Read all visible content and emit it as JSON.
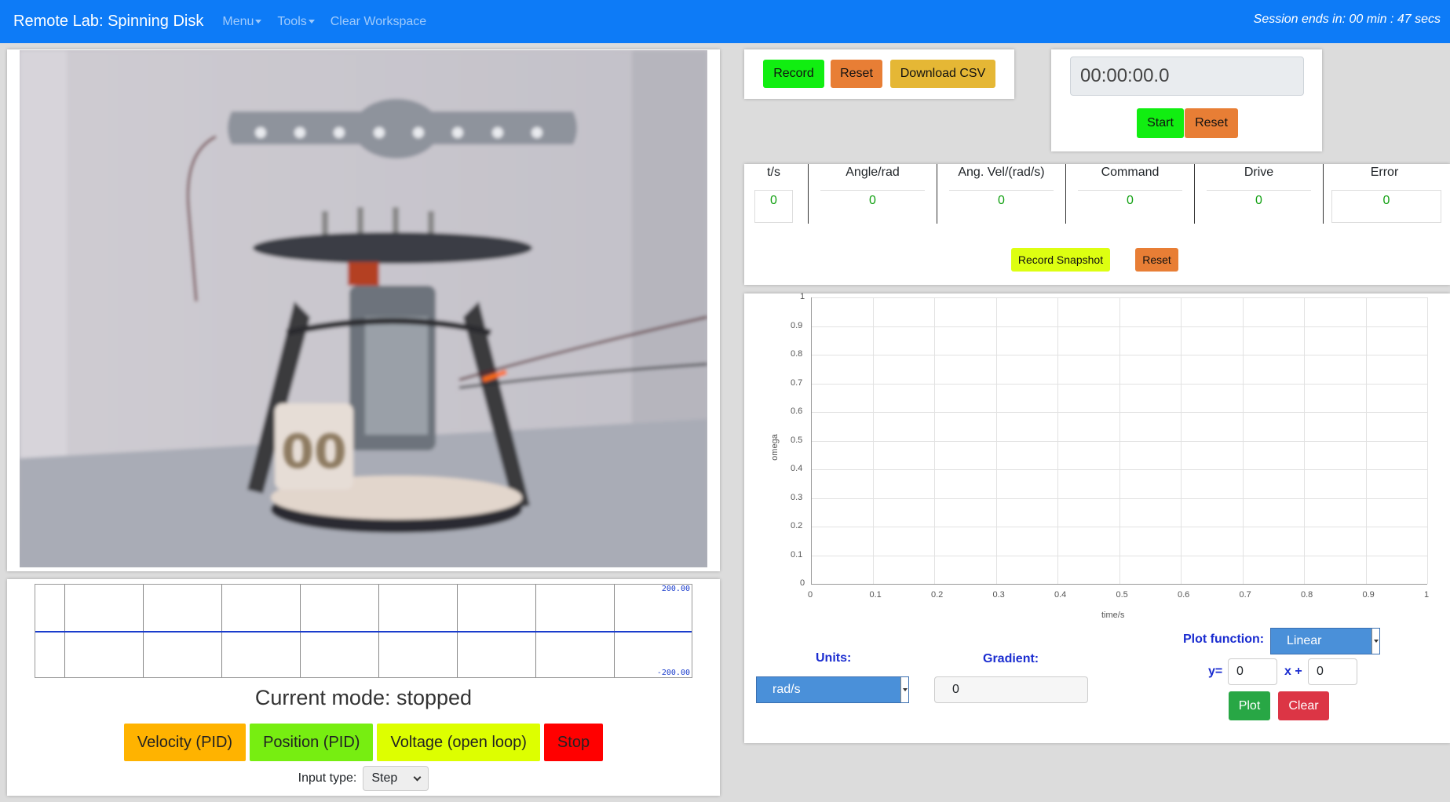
{
  "navbar": {
    "brand": "Remote Lab: Spinning Disk",
    "menu": "Menu",
    "tools": "Tools",
    "clear": "Clear Workspace",
    "session": "Session ends in: 00 min : 47 secs"
  },
  "video": {
    "disk_label": "00"
  },
  "strip_chart": {
    "max_label": "200.00",
    "min_label": "-200.00"
  },
  "mode": {
    "text": "Current mode: stopped"
  },
  "mode_buttons": [
    {
      "label": "Velocity (PID)",
      "color": "#ffb300"
    },
    {
      "label": "Position (PID)",
      "color": "#77ee11"
    },
    {
      "label": "Voltage (open loop)",
      "color": "#ddff00"
    },
    {
      "label": "Stop",
      "color": "#ff0000"
    }
  ],
  "input_type": {
    "label": "Input type:",
    "value": "Step"
  },
  "record": {
    "record": "Record",
    "reset": "Reset",
    "download": "Download CSV"
  },
  "timer": {
    "display": "00:00:00.0",
    "start": "Start",
    "reset": "Reset"
  },
  "table": {
    "columns": [
      {
        "header": "t/s",
        "value": "0"
      },
      {
        "header": "Angle/rad",
        "value": "0"
      },
      {
        "header": "Ang. Vel/(rad/s)",
        "value": "0"
      },
      {
        "header": "Command",
        "value": "0"
      },
      {
        "header": "Drive",
        "value": "0"
      },
      {
        "header": "Error",
        "value": "0"
      }
    ],
    "snapshot": "Record Snapshot",
    "reset": "Reset"
  },
  "chart_data": {
    "type": "line",
    "title": "",
    "xlabel": "time/s",
    "ylabel": "omega",
    "xlim": [
      0,
      1
    ],
    "ylim": [
      0,
      1
    ],
    "x_ticks": [
      "0",
      "0.1",
      "0.2",
      "0.3",
      "0.4",
      "0.5",
      "0.6",
      "0.7",
      "0.8",
      "0.9",
      "1"
    ],
    "y_ticks": [
      "0",
      "0.1",
      "0.2",
      "0.3",
      "0.4",
      "0.5",
      "0.6",
      "0.7",
      "0.8",
      "0.9",
      "1"
    ],
    "grid": true,
    "series": []
  },
  "graph_controls": {
    "units_label": "Units:",
    "units_value": "rad/s",
    "gradient_label": "Gradient:",
    "gradient_value": "0",
    "plot_function_label": "Plot function:",
    "plot_function_value": "Linear",
    "y_eq": "y=",
    "m_value": "0",
    "x_plus": "x +",
    "c_value": "0",
    "plot": "Plot",
    "clear": "Clear"
  }
}
